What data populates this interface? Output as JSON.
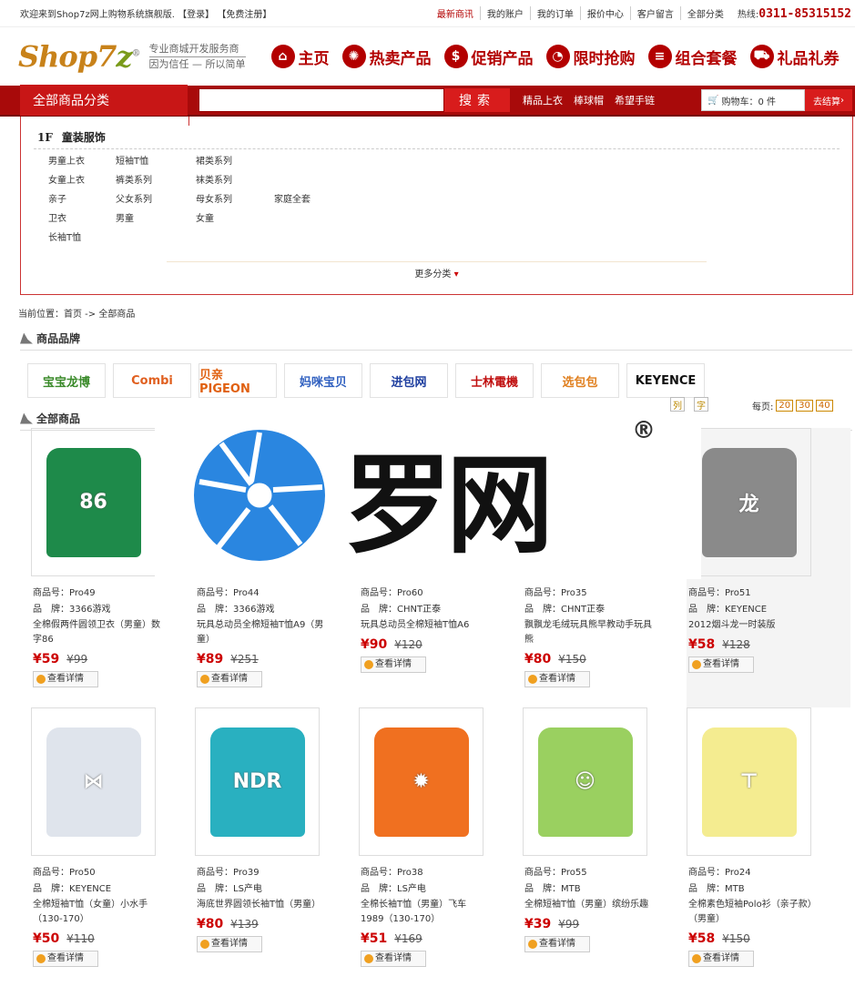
{
  "topbar": {
    "welcome": "欢迎来到Shop7z网上购物系统旗舰版.",
    "login": "【登录】",
    "register": "【免费注册】",
    "links": [
      "最新商讯",
      "我的账户",
      "我的订单",
      "报价中心",
      "客户留言",
      "全部分类"
    ],
    "hotline_label": "热线:",
    "hotline": "0311-85315152"
  },
  "header": {
    "logo_a": "Shop7",
    "logo_b": "z",
    "logo_reg": "®",
    "slogan1": "专业商城开发服务商",
    "slogan2": "因为信任 — 所以简单",
    "nav": [
      {
        "label": "主页",
        "icon": "home-icon",
        "glyph": "⌂"
      },
      {
        "label": "热卖产品",
        "icon": "hot-sale-icon",
        "glyph": "✺"
      },
      {
        "label": "促销产品",
        "icon": "dollar-icon",
        "glyph": "$"
      },
      {
        "label": "限时抢购",
        "icon": "clock-icon",
        "glyph": "◔"
      },
      {
        "label": "组合套餐",
        "icon": "stack-icon",
        "glyph": "≡"
      },
      {
        "label": "礼品礼券",
        "icon": "cart-icon",
        "glyph": "⛟"
      }
    ]
  },
  "searchbar": {
    "all_categories": "全部商品分类",
    "search_button": "搜索",
    "search_value": "",
    "hot_keywords": [
      "精品上衣",
      "棒球帽",
      "希望手链"
    ],
    "cart": "购物车：0 件",
    "checkout": "去结算"
  },
  "category": {
    "floor_no": "1F",
    "floor_title": "童装服饰",
    "items": [
      "男童上衣",
      "短袖T恤",
      "裙类系列",
      "",
      "女童上衣",
      "裤类系列",
      "袜类系列",
      "",
      "亲子",
      "父女系列",
      "母女系列",
      "家庭全套",
      "卫衣",
      "男童",
      "女童",
      "",
      "长袖T恤",
      "",
      "",
      ""
    ],
    "more": "更多分类",
    "more_arrow": "▾"
  },
  "breadcrumb": "当前位置：首页 -> 全部商品",
  "brands_title": "商品品牌",
  "brands": [
    {
      "name": "宝宝龙博",
      "color": "#3a8a2a"
    },
    {
      "name": "Combi",
      "color": "#e06020"
    },
    {
      "name": "贝亲 PIGEON",
      "color": "#e06010"
    },
    {
      "name": "妈咪宝贝",
      "color": "#3060c0"
    },
    {
      "name": "进包网",
      "color": "#2040a0"
    },
    {
      "name": "士林電機",
      "color": "#c01010"
    },
    {
      "name": "选包包",
      "color": "#e08020"
    },
    {
      "name": "KEYENCE",
      "color": "#111111"
    }
  ],
  "all_products_title": "全部商品",
  "view_icons": [
    "列",
    "字"
  ],
  "perpage_label": "每页:",
  "perpage": [
    "20",
    "30",
    "40"
  ],
  "labels": {
    "sku": "商品号：",
    "brand": "品　牌：",
    "detail": "查看详情"
  },
  "products": [
    {
      "sku": "Pro49",
      "brand": "3366游戏",
      "name": "全棉假两件圆领卫衣（男童）数字86",
      "price": "¥59",
      "old": "¥99",
      "icon": "green-sweatshirt-image",
      "color": "#1e8a4a",
      "glyph": "86"
    },
    {
      "sku": "Pro44",
      "brand": "3366游戏",
      "name": "玩具总动员全棉短袖T恤A9（男童）",
      "price": "¥89",
      "old": "¥251",
      "icon": "tshirt-image",
      "color": "#4a90c0",
      "glyph": "A9"
    },
    {
      "sku": "Pro60",
      "brand": "CHNT正泰",
      "name": "玩具总动员全棉短袖T恤A6",
      "price": "¥90",
      "old": "¥120",
      "icon": "tshirt-image",
      "color": "#e0a040",
      "glyph": "A6"
    },
    {
      "sku": "Pro35",
      "brand": "CHNT正泰",
      "name": "飘飘龙毛绒玩具熊早教动手玩具熊",
      "price": "¥80",
      "old": "¥150",
      "icon": "plush-bear-image",
      "color": "#b07040",
      "glyph": "熊"
    },
    {
      "sku": "Pro51",
      "brand": "KEYENCE",
      "name": "2012烟斗龙一时装版",
      "price": "¥58",
      "old": "¥128",
      "icon": "plush-toy-image",
      "color": "#8a8a8a",
      "glyph": "龙"
    },
    {
      "sku": "Pro50",
      "brand": "KEYENCE",
      "name": "全棉短袖T恤（女童）小水手（130-170）",
      "price": "¥50",
      "old": "¥110",
      "icon": "white-sailor-tshirt-image",
      "color": "#dfe4ec",
      "glyph": "⋈"
    },
    {
      "sku": "Pro39",
      "brand": "LS产电",
      "name": "海底世界圆领长袖T恤（男童）",
      "price": "¥80",
      "old": "¥139",
      "icon": "raglan-tshirt-image",
      "color": "#29b0c0",
      "glyph": "NDR"
    },
    {
      "sku": "Pro38",
      "brand": "LS产电",
      "name": "全棉长袖T恤（男童）飞车1989（130-170）",
      "price": "¥51",
      "old": "¥169",
      "icon": "orange-tshirt-image",
      "color": "#f07020",
      "glyph": "✹"
    },
    {
      "sku": "Pro55",
      "brand": "MTB",
      "name": "全棉短袖T恤（男童）缤纷乐趣",
      "price": "¥39",
      "old": "¥99",
      "icon": "green-tshirt-image",
      "color": "#9ad060",
      "glyph": "☺"
    },
    {
      "sku": "Pro24",
      "brand": "MTB",
      "name": "全棉素色短袖Polo衫（亲子款）（男童）",
      "price": "¥58",
      "old": "¥150",
      "icon": "yellow-polo-image",
      "color": "#f4ec90",
      "glyph": "⊤"
    }
  ],
  "watermark": {
    "text": "罗网",
    "reg": "®",
    "color": "#2a86e0"
  }
}
